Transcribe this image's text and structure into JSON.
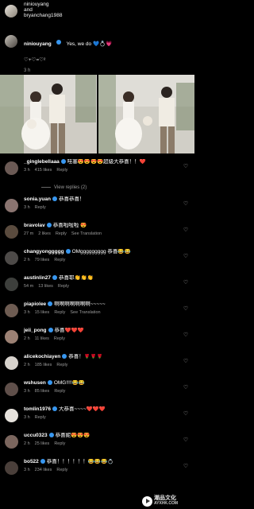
{
  "header": {
    "line1": "niniouyang",
    "line2": "and",
    "line3": "bryanchang1988"
  },
  "post": {
    "username": "niniouyang",
    "caption": "Yes, we do 💙💍💗",
    "emoji_line": "♡+♡=♡²",
    "age": "3 h"
  },
  "comments": [
    {
      "user": "_ginglebellaaa",
      "verified": true,
      "text": "哇塞😍😍😍😍超級大恭喜！！❤️",
      "time": "3 h",
      "likes": "415 likes",
      "reply": "Reply",
      "translate": ""
    },
    {
      "user": "sonia.yuan",
      "verified": true,
      "text": "恭喜恭喜！",
      "time": "3 h",
      "likes": "",
      "reply": "Reply",
      "translate": ""
    },
    {
      "user": "bravolav",
      "verified": true,
      "text": "恭喜啦啦啦 😍",
      "time": "27 m",
      "likes": "2 likes",
      "reply": "Reply",
      "translate": "See Translation"
    },
    {
      "user": "changyonggggg",
      "verified": true,
      "text": "OMggggggggg 恭喜😂😂",
      "time": "2 h",
      "likes": "79 likes",
      "reply": "Reply",
      "translate": ""
    },
    {
      "user": "austinlin27",
      "verified": true,
      "text": "恭喜耶👏👏👏",
      "time": "54 m",
      "likes": "13 likes",
      "reply": "Reply",
      "translate": ""
    },
    {
      "user": "piapiolee",
      "verified": true,
      "text": "啊啊啊啊啊啊啊~~~~~",
      "time": "3 h",
      "likes": "15 likes",
      "reply": "Reply",
      "translate": "See Translation"
    },
    {
      "user": "jeii_pong",
      "verified": true,
      "text": "恭喜❤️❤️❤️",
      "time": "2 h",
      "likes": "11 likes",
      "reply": "Reply",
      "translate": ""
    },
    {
      "user": "alicekochiayen",
      "verified": true,
      "text": "恭喜！🌹🌹🌹",
      "time": "2 h",
      "likes": "185 likes",
      "reply": "Reply",
      "translate": ""
    },
    {
      "user": "wshusen",
      "verified": true,
      "text": "OMG!!!!😂😂",
      "time": "3 h",
      "likes": "85 likes",
      "reply": "Reply",
      "translate": ""
    },
    {
      "user": "tomlin1976",
      "verified": true,
      "text": "大恭喜~~~~❤️❤️❤️",
      "time": "3 h",
      "likes": "",
      "reply": "Reply",
      "translate": ""
    },
    {
      "user": "uccu0323",
      "verified": true,
      "text": "恭喜妮😍😍😍",
      "time": "2 h",
      "likes": "25 likes",
      "reply": "Reply",
      "translate": ""
    },
    {
      "user": "bo522",
      "verified": true,
      "text": "恭喜！！！！！！😂😂😂💍",
      "time": "3 h",
      "likes": "234 likes",
      "reply": "Reply",
      "translate": ""
    }
  ],
  "view_replies": "View replies (2)",
  "watermark": {
    "title": "潮品文化",
    "sub": "AYXHK.COM"
  },
  "colors": {
    "background": "#000000",
    "muted": "#9a9a9a",
    "verified": "#3897f0"
  }
}
